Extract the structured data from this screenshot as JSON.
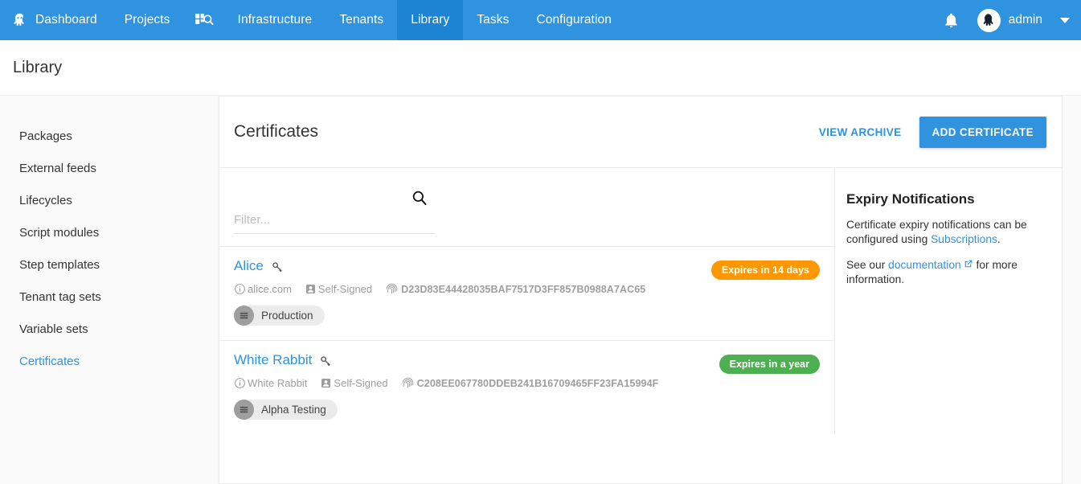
{
  "topnav": {
    "brand_icon": "octopus-logo-icon",
    "items": [
      {
        "label": "Dashboard",
        "icon": "octopus-logo-icon",
        "active": false
      },
      {
        "label": "Projects",
        "icon": null,
        "active": false
      },
      {
        "label": "",
        "icon": "grid-search-icon",
        "active": false
      },
      {
        "label": "Infrastructure",
        "icon": null,
        "active": false
      },
      {
        "label": "Tenants",
        "icon": null,
        "active": false
      },
      {
        "label": "Library",
        "icon": null,
        "active": true
      },
      {
        "label": "Tasks",
        "icon": null,
        "active": false
      },
      {
        "label": "Configuration",
        "icon": null,
        "active": false
      }
    ],
    "bell_icon": "notification-bell-icon",
    "avatar_icon": "octopus-avatar-icon",
    "username": "admin",
    "caret_icon": "chevron-down-icon"
  },
  "page": {
    "title": "Library"
  },
  "sidebar": {
    "items": [
      {
        "label": "Packages",
        "active": false
      },
      {
        "label": "External feeds",
        "active": false
      },
      {
        "label": "Lifecycles",
        "active": false
      },
      {
        "label": "Script modules",
        "active": false
      },
      {
        "label": "Step templates",
        "active": false
      },
      {
        "label": "Tenant tag sets",
        "active": false
      },
      {
        "label": "Variable sets",
        "active": false
      },
      {
        "label": "Certificates",
        "active": true
      }
    ]
  },
  "card": {
    "title": "Certificates",
    "view_archive_label": "VIEW ARCHIVE",
    "add_certificate_label": "ADD CERTIFICATE"
  },
  "filter": {
    "placeholder": "Filter...",
    "value": "",
    "search_icon": "search-icon"
  },
  "certificates": [
    {
      "name": "Alice",
      "key_icon": "key-icon",
      "subject_icon": "info-icon",
      "subject": "alice.com",
      "issuer_icon": "person-badge-icon",
      "issuer": "Self-Signed",
      "thumbprint_icon": "fingerprint-icon",
      "thumbprint": "D23D83E44428035BAF7517D3FF857B0988A7AC65",
      "environments": [
        {
          "label": "Production",
          "icon": "environment-icon"
        }
      ],
      "expiry_label": "Expires in 14 days",
      "expiry_color": "#ff9800"
    },
    {
      "name": "White Rabbit",
      "key_icon": "key-icon",
      "subject_icon": "info-icon",
      "subject": "White Rabbit",
      "issuer_icon": "person-badge-icon",
      "issuer": "Self-Signed",
      "thumbprint_icon": "fingerprint-icon",
      "thumbprint": "C208EE067780DDEB241B16709465FF23FA15994F",
      "environments": [
        {
          "label": "Alpha Testing",
          "icon": "environment-icon"
        }
      ],
      "expiry_label": "Expires in a year",
      "expiry_color": "#4caf50"
    }
  ],
  "expiry_panel": {
    "title": "Expiry Notifications",
    "paragraph1_before": "Certificate expiry notifications can be configured using ",
    "paragraph1_link": "Subscriptions",
    "paragraph1_after": ".",
    "paragraph2_before": "See our ",
    "paragraph2_link": "documentation",
    "paragraph2_link_icon": "external-link-icon",
    "paragraph2_after": " for more information."
  },
  "colors": {
    "nav_background": "#2f93e0",
    "nav_active": "#1d84d4",
    "accent": "#2f93e0",
    "body_background": "#fafafa",
    "warning": "#ff9800",
    "success": "#4caf50"
  }
}
